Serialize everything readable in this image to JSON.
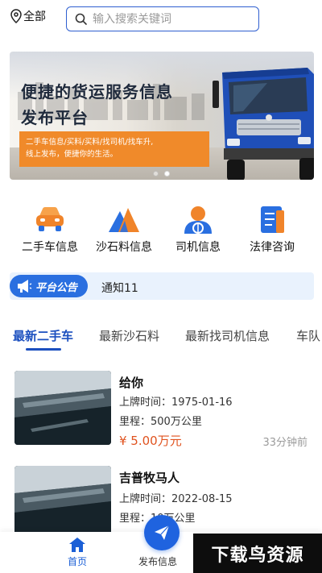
{
  "location": {
    "label": "全部",
    "icon": "location-pin-icon"
  },
  "search": {
    "placeholder": "输入搜索关键词",
    "icon": "search-icon"
  },
  "banner": {
    "title_line1": "便捷的货运服务信息",
    "title_line2": "发布平台",
    "subtitle_line1": "二手车信息/买料/买料/找司机/找车升,",
    "subtitle_line2": "线上发布，便捷你的生活。",
    "slide_count": 2,
    "active_slide": 2
  },
  "categories": [
    {
      "label": "二手车信息",
      "icon": "car-icon",
      "color": "#f0842a"
    },
    {
      "label": "沙石料信息",
      "icon": "sand-mountain-icon",
      "color": "#2a6fe0"
    },
    {
      "label": "司机信息",
      "icon": "driver-icon",
      "color": "#2a6fe0"
    },
    {
      "label": "法律咨询",
      "icon": "document-icon",
      "color": "#2a6fe0"
    }
  ],
  "notice": {
    "badge": "平台公告",
    "text": "通知11",
    "icon": "megaphone-icon"
  },
  "tabs": [
    {
      "label": "最新二手车",
      "active": true
    },
    {
      "label": "最新沙石料",
      "active": false
    },
    {
      "label": "最新找司机信息",
      "active": false
    },
    {
      "label": "车队",
      "active": false
    }
  ],
  "listings": [
    {
      "title": "给你",
      "plate_label": "上牌时间：",
      "plate_date": "1975-01-16",
      "mileage_label": "里程：",
      "mileage": "500万公里",
      "price": "¥ 5.00万元",
      "ago": "33分钟前"
    },
    {
      "title": "吉普牧马人",
      "plate_label": "上牌时间：",
      "plate_date": "2022-08-15",
      "mileage_label": "里程：",
      "mileage": "10万公里",
      "price": "",
      "ago": ""
    }
  ],
  "bottom_nav": {
    "home": "首页",
    "publish": "发布信息"
  },
  "watermark": "下载鸟资源",
  "colors": {
    "primary": "#1b4fbf",
    "accent_orange": "#f08a2a",
    "price": "#e0531f"
  }
}
